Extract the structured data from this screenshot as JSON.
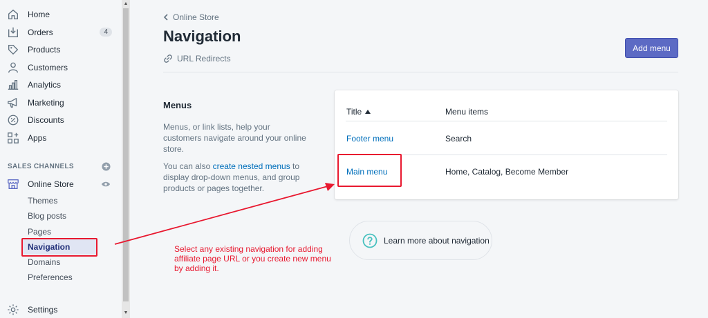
{
  "sidebar": {
    "items": [
      {
        "label": "Home",
        "icon": "home-icon"
      },
      {
        "label": "Orders",
        "icon": "orders-icon",
        "badge": "4"
      },
      {
        "label": "Products",
        "icon": "tag-icon"
      },
      {
        "label": "Customers",
        "icon": "person-icon"
      },
      {
        "label": "Analytics",
        "icon": "analytics-icon"
      },
      {
        "label": "Marketing",
        "icon": "megaphone-icon"
      },
      {
        "label": "Discounts",
        "icon": "discount-icon"
      },
      {
        "label": "Apps",
        "icon": "apps-icon"
      }
    ],
    "sales_channels_heading": "SALES CHANNELS",
    "online_store": {
      "label": "Online Store",
      "sub_items": [
        "Themes",
        "Blog posts",
        "Pages",
        "Navigation",
        "Domains",
        "Preferences"
      ],
      "active": "Navigation"
    },
    "settings_label": "Settings"
  },
  "page": {
    "breadcrumb": "Online Store",
    "title": "Navigation",
    "redirects_label": "URL Redirects",
    "add_menu_label": "Add menu"
  },
  "menus_section": {
    "title": "Menus",
    "description": "Menus, or link lists, help your customers navigate around your online store.",
    "desc2_prefix": "You can also ",
    "desc2_link": "create nested menus",
    "desc2_suffix": " to display drop-down menus, and group products or pages together."
  },
  "table": {
    "columns": [
      "Title",
      "Menu items"
    ],
    "rows": [
      {
        "title": "Footer menu",
        "items": "Search"
      },
      {
        "title": "Main menu",
        "items": "Home, Catalog, Become Member"
      }
    ]
  },
  "learn_more": {
    "prefix": "Learn more about ",
    "link": "navigation"
  },
  "annotation": "Select any existing navigation for adding affiliate page URL or you create new menu by adding it.",
  "colors": {
    "primary_button": "#5c6ac4",
    "link": "#006fbb",
    "annotation_red": "#e8182f",
    "active_nav_bg": "#e0e5f3"
  }
}
